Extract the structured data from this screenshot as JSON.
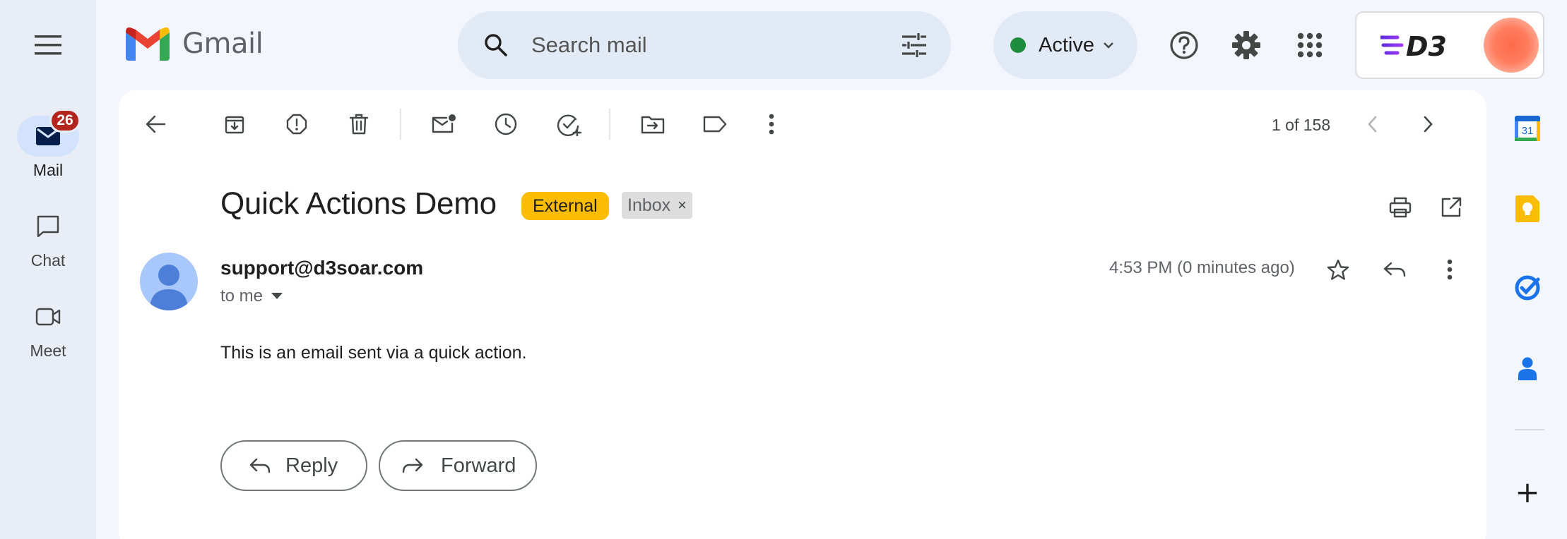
{
  "brand": {
    "name": "Gmail"
  },
  "search": {
    "placeholder": "Search mail"
  },
  "status": {
    "label": "Active",
    "color": "#1e8e3e"
  },
  "account": {
    "logo_text": "D3"
  },
  "nav": {
    "items": [
      {
        "label": "Mail",
        "icon": "mail-icon",
        "badge": "26",
        "active": true
      },
      {
        "label": "Chat",
        "icon": "chat-icon",
        "active": false
      },
      {
        "label": "Meet",
        "icon": "meet-icon",
        "active": false
      }
    ]
  },
  "toolbar": {
    "icons": [
      "back-arrow-icon",
      "archive-icon",
      "report-spam-icon",
      "delete-icon",
      "mark-unread-icon",
      "snooze-icon",
      "add-to-tasks-icon",
      "move-to-icon",
      "label-icon",
      "more-vert-icon"
    ],
    "pager": "1 of 158"
  },
  "email": {
    "subject": "Quick Actions Demo",
    "labels": [
      {
        "text": "External",
        "color": "#fbbc04"
      },
      {
        "text": "Inbox",
        "removable": true,
        "remove_glyph": "×"
      }
    ],
    "sender": "support@d3soar.com",
    "recipient_label": "to me",
    "time": "4:53 PM (0 minutes ago)",
    "body": "This is an email sent via a quick action."
  },
  "actions": {
    "reply_label": "Reply",
    "forward_label": "Forward"
  },
  "side_panel": {
    "calendar_day": "31",
    "apps": [
      "calendar-icon",
      "keep-icon",
      "tasks-icon",
      "contacts-icon"
    ],
    "add_glyph": "+"
  }
}
